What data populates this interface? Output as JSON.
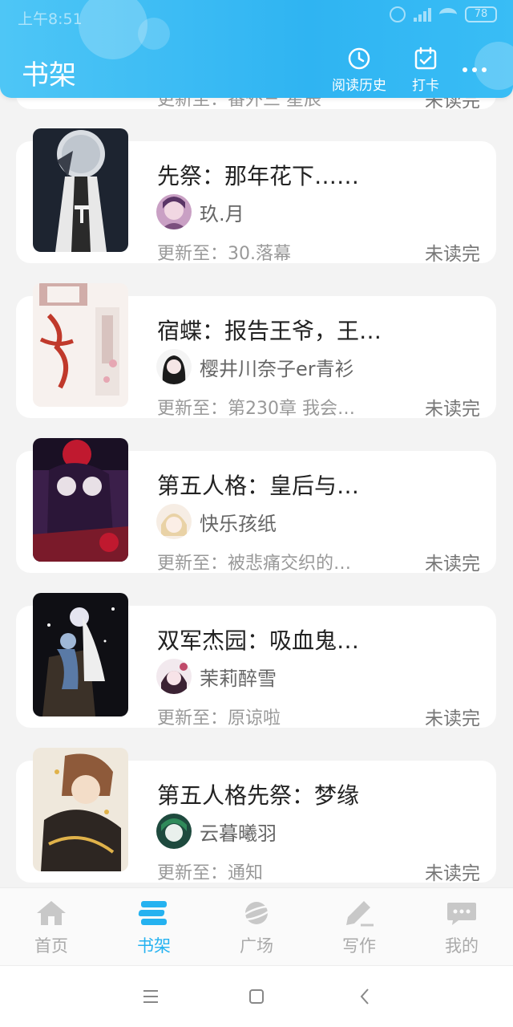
{
  "status_bar": {
    "time": "上午8:51",
    "battery": "78"
  },
  "header": {
    "title": "书架",
    "history_label": "阅读历史",
    "checkin_label": "打卡"
  },
  "partial_book": {
    "update": "更新至：番外三 星辰",
    "status": "未读完"
  },
  "books": [
    {
      "title": "先祭：那年花下……",
      "author": "玖.月",
      "update": "更新至：30.落幕",
      "status": "未读完"
    },
    {
      "title": "宿蝶：报告王爷，王…",
      "author": "樱井川奈子er青衫",
      "update": "更新至：第230章  我会…",
      "status": "未读完"
    },
    {
      "title": "第五人格：皇后与…",
      "author": "快乐孩纸",
      "update": "更新至：被悲痛交织的…",
      "status": "未读完"
    },
    {
      "title": "双军杰园：吸血鬼…",
      "author": "茉莉醉雪",
      "update": "更新至：原谅啦",
      "status": "未读完"
    },
    {
      "title": "第五人格先祭：梦缘",
      "author": "云暮曦羽",
      "update": "更新至：通知",
      "status": "未读完"
    }
  ],
  "bottom_nav": [
    {
      "label": "首页",
      "icon": "home-icon",
      "active": false
    },
    {
      "label": "书架",
      "icon": "bookshelf-icon",
      "active": true
    },
    {
      "label": "广场",
      "icon": "planet-icon",
      "active": false
    },
    {
      "label": "写作",
      "icon": "pen-icon",
      "active": false
    },
    {
      "label": "我的",
      "icon": "chat-bubble-icon",
      "active": false
    }
  ],
  "colors": {
    "accent": "#25b2f0",
    "header": "#3bbcf5",
    "background": "#f3f3f3"
  }
}
